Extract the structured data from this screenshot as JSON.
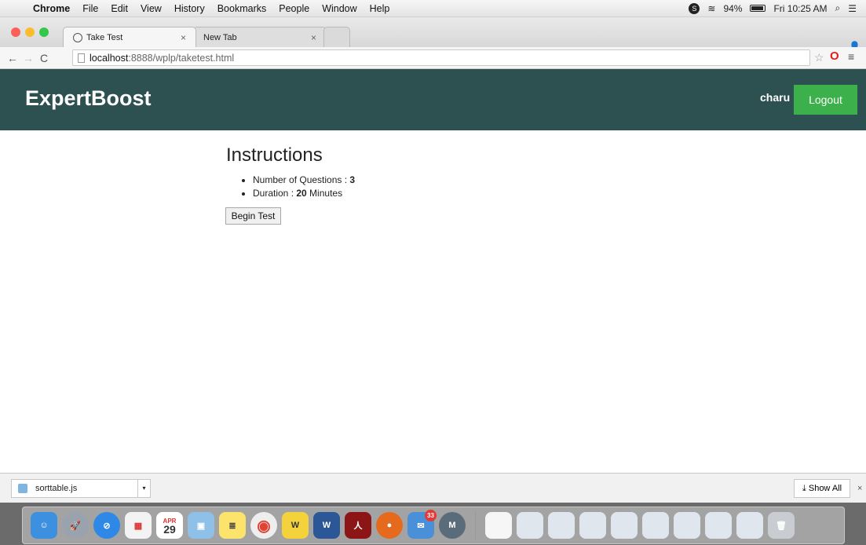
{
  "menubar": {
    "app": "Chrome",
    "items": [
      "File",
      "Edit",
      "View",
      "History",
      "Bookmarks",
      "People",
      "Window",
      "Help"
    ],
    "battery": "94%",
    "clock": "Fri 10:25 AM"
  },
  "browser": {
    "tabs": [
      {
        "label": "Take Test"
      },
      {
        "label": "New Tab"
      }
    ],
    "url_host": "localhost",
    "url_path": ":8888/wplp/taketest.html"
  },
  "site": {
    "brand": "ExpertBoost",
    "username": "charu",
    "logout_label": "Logout",
    "header_color": "#2d5050",
    "logout_color": "#3cb04a"
  },
  "instructions": {
    "heading": "Instructions",
    "questions_label": "Number of Questions : ",
    "questions_value": "3",
    "duration_label": "Duration : ",
    "duration_value": "20",
    "duration_unit": " Minutes",
    "begin_label": "Begin Test"
  },
  "downloads": {
    "file": "sorttable.js",
    "show_all": "Show All"
  },
  "dock": {
    "calendar_day": "29",
    "calendar_month": "APR",
    "mail_badge": "33"
  }
}
